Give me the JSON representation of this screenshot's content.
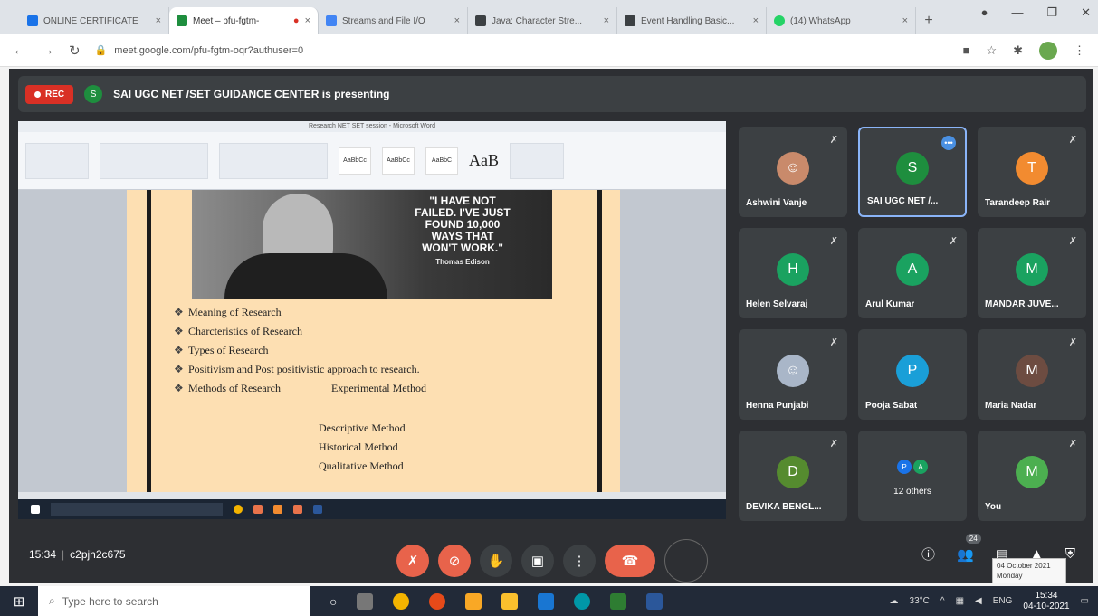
{
  "browser": {
    "tabs": [
      {
        "label": "ONLINE CERTIFICATE",
        "color": "#1a73e8"
      },
      {
        "label": "Meet – pfu-fgtm-",
        "color": "#1e8e3e",
        "active": true
      },
      {
        "label": "Streams and File I/O",
        "color": "#4285f4"
      },
      {
        "label": "Java: Character Stre...",
        "color": "#3c4043"
      },
      {
        "label": "Event Handling Basic...",
        "color": "#3c4043"
      },
      {
        "label": "(14) WhatsApp",
        "color": "#25d366"
      }
    ],
    "close_glyph": "×",
    "new_tab_glyph": "+",
    "url": "meet.google.com/pfu-fgtm-oqr?authuser=0"
  },
  "meet": {
    "rec_label": "REC",
    "presenter_initial": "S",
    "presenting_text": "SAI UGC NET /SET GUIDANCE CENTER is presenting",
    "shared_doc": {
      "window_title": "Research NET SET session - Microsoft Word",
      "style_big": "AaB",
      "quote_lines": [
        "\"I HAVE NOT",
        "FAILED. I'VE JUST",
        "FOUND 10,000",
        "WAYS THAT",
        "WON'T WORK.\""
      ],
      "quote_author": "Thomas Edison",
      "bullets": [
        "Meaning of Research",
        "Charcteristics of Research",
        "Types of Research",
        "Positivism and Post positivistic approach to research."
      ],
      "methods_label": "Methods of Research",
      "methods": [
        "Experimental Method",
        "Descriptive Method",
        "Historical Method",
        "Qualitative Method"
      ]
    },
    "participants": [
      {
        "name": "Ashwini Vanje",
        "initial": "",
        "color": "#c98a6b",
        "photo": true
      },
      {
        "name": "SAI UGC NET /...",
        "initial": "S",
        "color": "#1e8e3e",
        "active": true
      },
      {
        "name": "Tarandeep Rair",
        "initial": "T",
        "color": "#f28b30"
      },
      {
        "name": "Helen Selvaraj",
        "initial": "H",
        "color": "#1aa260"
      },
      {
        "name": "Arul Kumar",
        "initial": "A",
        "color": "#1aa260"
      },
      {
        "name": "MANDAR JUVE...",
        "initial": "M",
        "color": "#1aa260"
      },
      {
        "name": "Henna Punjabi",
        "initial": "",
        "color": "#a9b6c8",
        "photo": true
      },
      {
        "name": "Pooja Sabat",
        "initial": "P",
        "color": "#1a9fd8"
      },
      {
        "name": "Maria Nadar",
        "initial": "M",
        "color": "#6d4c41"
      },
      {
        "name": "DEVIKA BENGL...",
        "initial": "D",
        "color": "#558b2f"
      },
      {
        "name": "12 others",
        "others": true
      },
      {
        "name": "You",
        "initial": "M",
        "color": "#4caf50"
      }
    ],
    "others_initials": [
      "P",
      "A"
    ],
    "time": "15:34",
    "separator": "|",
    "meeting_code": "c2pjh2c675",
    "participant_count": "24",
    "tooltip_date": "04 October 2021",
    "tooltip_day": "Monday"
  },
  "taskbar": {
    "search_placeholder": "Type here to search",
    "temperature": "33°C",
    "language": "ENG",
    "clock_time": "15:34",
    "clock_date": "04-10-2021"
  }
}
